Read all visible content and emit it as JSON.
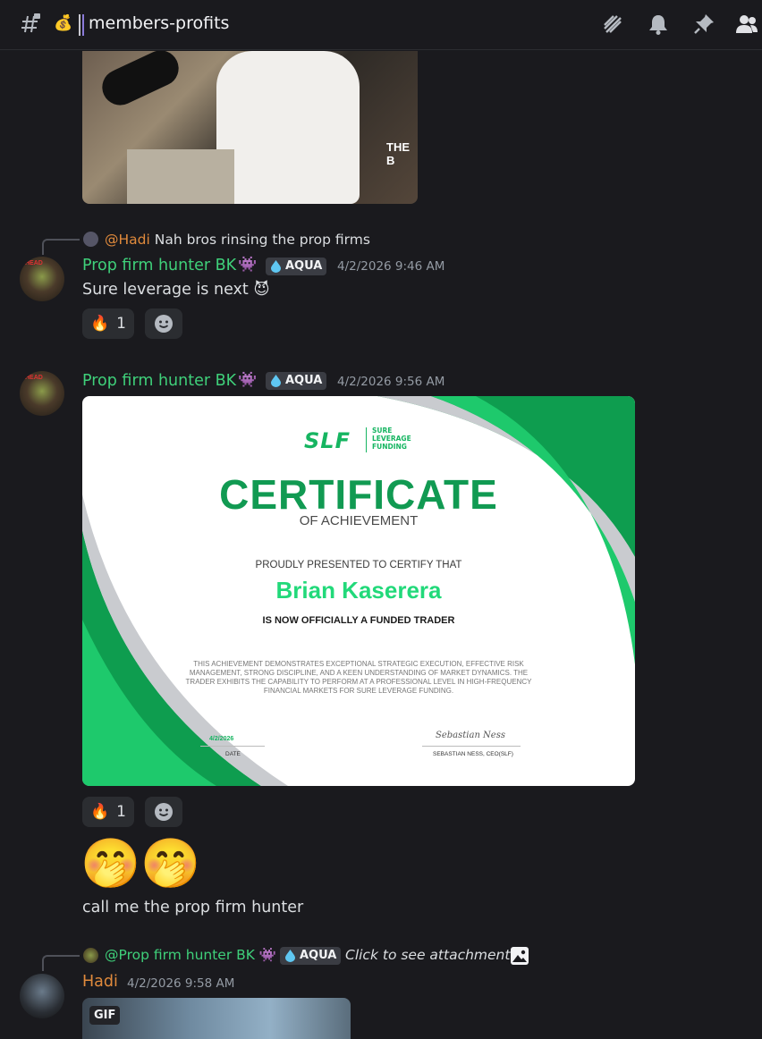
{
  "header": {
    "channel_icon": "hash-lock-icon",
    "channel_emoji": "💰",
    "channel_name": "members-profits",
    "icons": [
      "threads-icon",
      "bell-icon",
      "pin-icon",
      "members-icon"
    ]
  },
  "messages": [
    {
      "id": "msg1",
      "reply": {
        "mention": "@Hadi",
        "text": "Nah bros rinsing the prop firms"
      },
      "author": "Prop firm hunter BK",
      "author_emoji": "👾",
      "badge": "AQUA",
      "timestamp": "4/2/2026 9:46 AM",
      "text": "Sure leverage is next",
      "text_emoji": "😈",
      "reaction": {
        "emoji": "🔥",
        "count": "1"
      }
    },
    {
      "id": "msg2",
      "author": "Prop firm hunter BK",
      "author_emoji": "👾",
      "badge": "AQUA",
      "timestamp": "4/2/2026 9:56 AM",
      "certificate": {
        "logo": "SLF",
        "logo_sub": "SURE LEVERAGE FUNDING",
        "title": "CERTIFICATE",
        "subtitle": "OF ACHIEVEMENT",
        "presented": "PROUDLY PRESENTED TO CERTIFY THAT",
        "name": "Brian Kaserera",
        "funded": "IS NOW OFFICIALLY A FUNDED TRADER",
        "description": "THIS ACHIEVEMENT DEMONSTRATES EXCEPTIONAL STRATEGIC EXECUTION, EFFECTIVE RISK MANAGEMENT, STRONG DISCIPLINE, AND A KEEN UNDERSTANDING OF MARKET DYNAMICS. THE TRADER EXHIBITS THE CAPABILITY TO PERFORM AT A PROFESSIONAL LEVEL IN HIGH-FREQUENCY FINANCIAL MARKETS FOR SURE LEVERAGE FUNDING.",
        "date_value": "4/2/2026",
        "date_label": "DATE",
        "signature": "Sebastian Ness",
        "signer_label": "SEBASTIAN NESS, CEO(SLF)"
      },
      "reaction": {
        "emoji": "🔥",
        "count": "1"
      },
      "big_emojis": "🤭🤭",
      "text": "call me the prop firm hunter"
    },
    {
      "id": "msg3",
      "reply": {
        "mention": "@Prop firm hunter BK",
        "mention_emoji": "👾",
        "badge": "AQUA",
        "text": "Click to see attachment"
      },
      "author": "Hadi",
      "timestamp": "4/2/2026 9:58 AM",
      "gif_label": "GIF"
    }
  ],
  "colors": {
    "background": "#1a1a1e",
    "username_green": "#3fd07a",
    "username_orange": "#e08a3c",
    "timestamp": "#949ba4"
  }
}
